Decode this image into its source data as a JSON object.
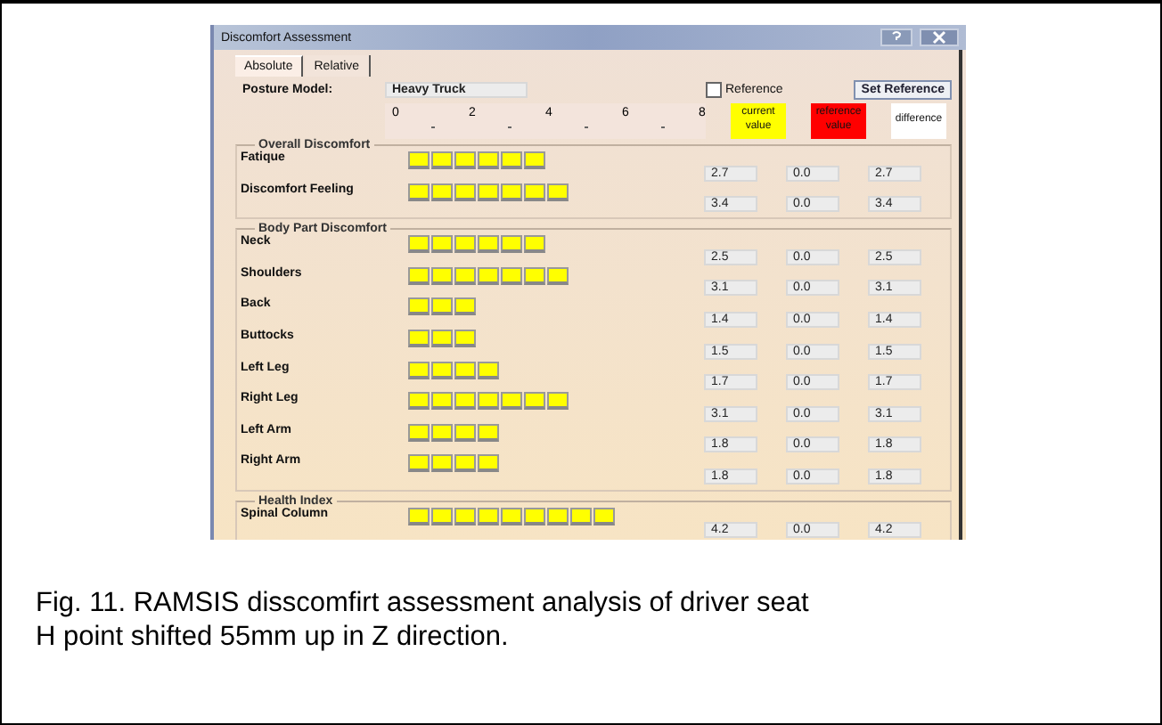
{
  "window": {
    "title": "Discomfort Assessment"
  },
  "tabs": [
    {
      "label": "Absolute",
      "selected": true
    },
    {
      "label": "Relative",
      "selected": false
    }
  ],
  "posture_model": {
    "label": "Posture Model:",
    "value": "Heavy Truck"
  },
  "reference": {
    "label": "Reference",
    "checked": false
  },
  "set_reference_button": "Set Reference",
  "scale": [
    "0",
    "2",
    "4",
    "6",
    "8"
  ],
  "legend": [
    {
      "label": "current value",
      "color": "#ffff00"
    },
    {
      "label": "reference value",
      "color": "#ff0000"
    },
    {
      "label": "difference",
      "color": "#ffffff"
    }
  ],
  "groups": [
    {
      "title": "Overall Discomfort",
      "rows": [
        {
          "label": "Fatique",
          "stars": 6,
          "current": "2.7",
          "reference": "0.0",
          "difference": "2.7"
        },
        {
          "label": "Discomfort Feeling",
          "stars": 7,
          "current": "3.4",
          "reference": "0.0",
          "difference": "3.4"
        }
      ]
    },
    {
      "title": "Body Part Discomfort",
      "rows": [
        {
          "label": "Neck",
          "stars": 6,
          "current": "2.5",
          "reference": "0.0",
          "difference": "2.5"
        },
        {
          "label": "Shoulders",
          "stars": 7,
          "current": "3.1",
          "reference": "0.0",
          "difference": "3.1"
        },
        {
          "label": "Back",
          "stars": 3,
          "current": "1.4",
          "reference": "0.0",
          "difference": "1.4"
        },
        {
          "label": "Buttocks",
          "stars": 3,
          "current": "1.5",
          "reference": "0.0",
          "difference": "1.5"
        },
        {
          "label": "Left Leg",
          "stars": 4,
          "current": "1.7",
          "reference": "0.0",
          "difference": "1.7"
        },
        {
          "label": "Right Leg",
          "stars": 7,
          "current": "3.1",
          "reference": "0.0",
          "difference": "3.1"
        },
        {
          "label": "Left Arm",
          "stars": 4,
          "current": "1.8",
          "reference": "0.0",
          "difference": "1.8"
        },
        {
          "label": "Right Arm",
          "stars": 4,
          "current": "1.8",
          "reference": "0.0",
          "difference": "1.8"
        }
      ]
    },
    {
      "title": "Health Index",
      "rows": [
        {
          "label": "Spinal Column",
          "stars": 9,
          "current": "4.2",
          "reference": "0.0",
          "difference": "4.2"
        }
      ]
    }
  ],
  "caption": {
    "line_1": "Fig. 11. RAMSIS disscomfirt assessment analysis of driver seat",
    "line_2": "H point shifted 55mm up in Z direction."
  }
}
